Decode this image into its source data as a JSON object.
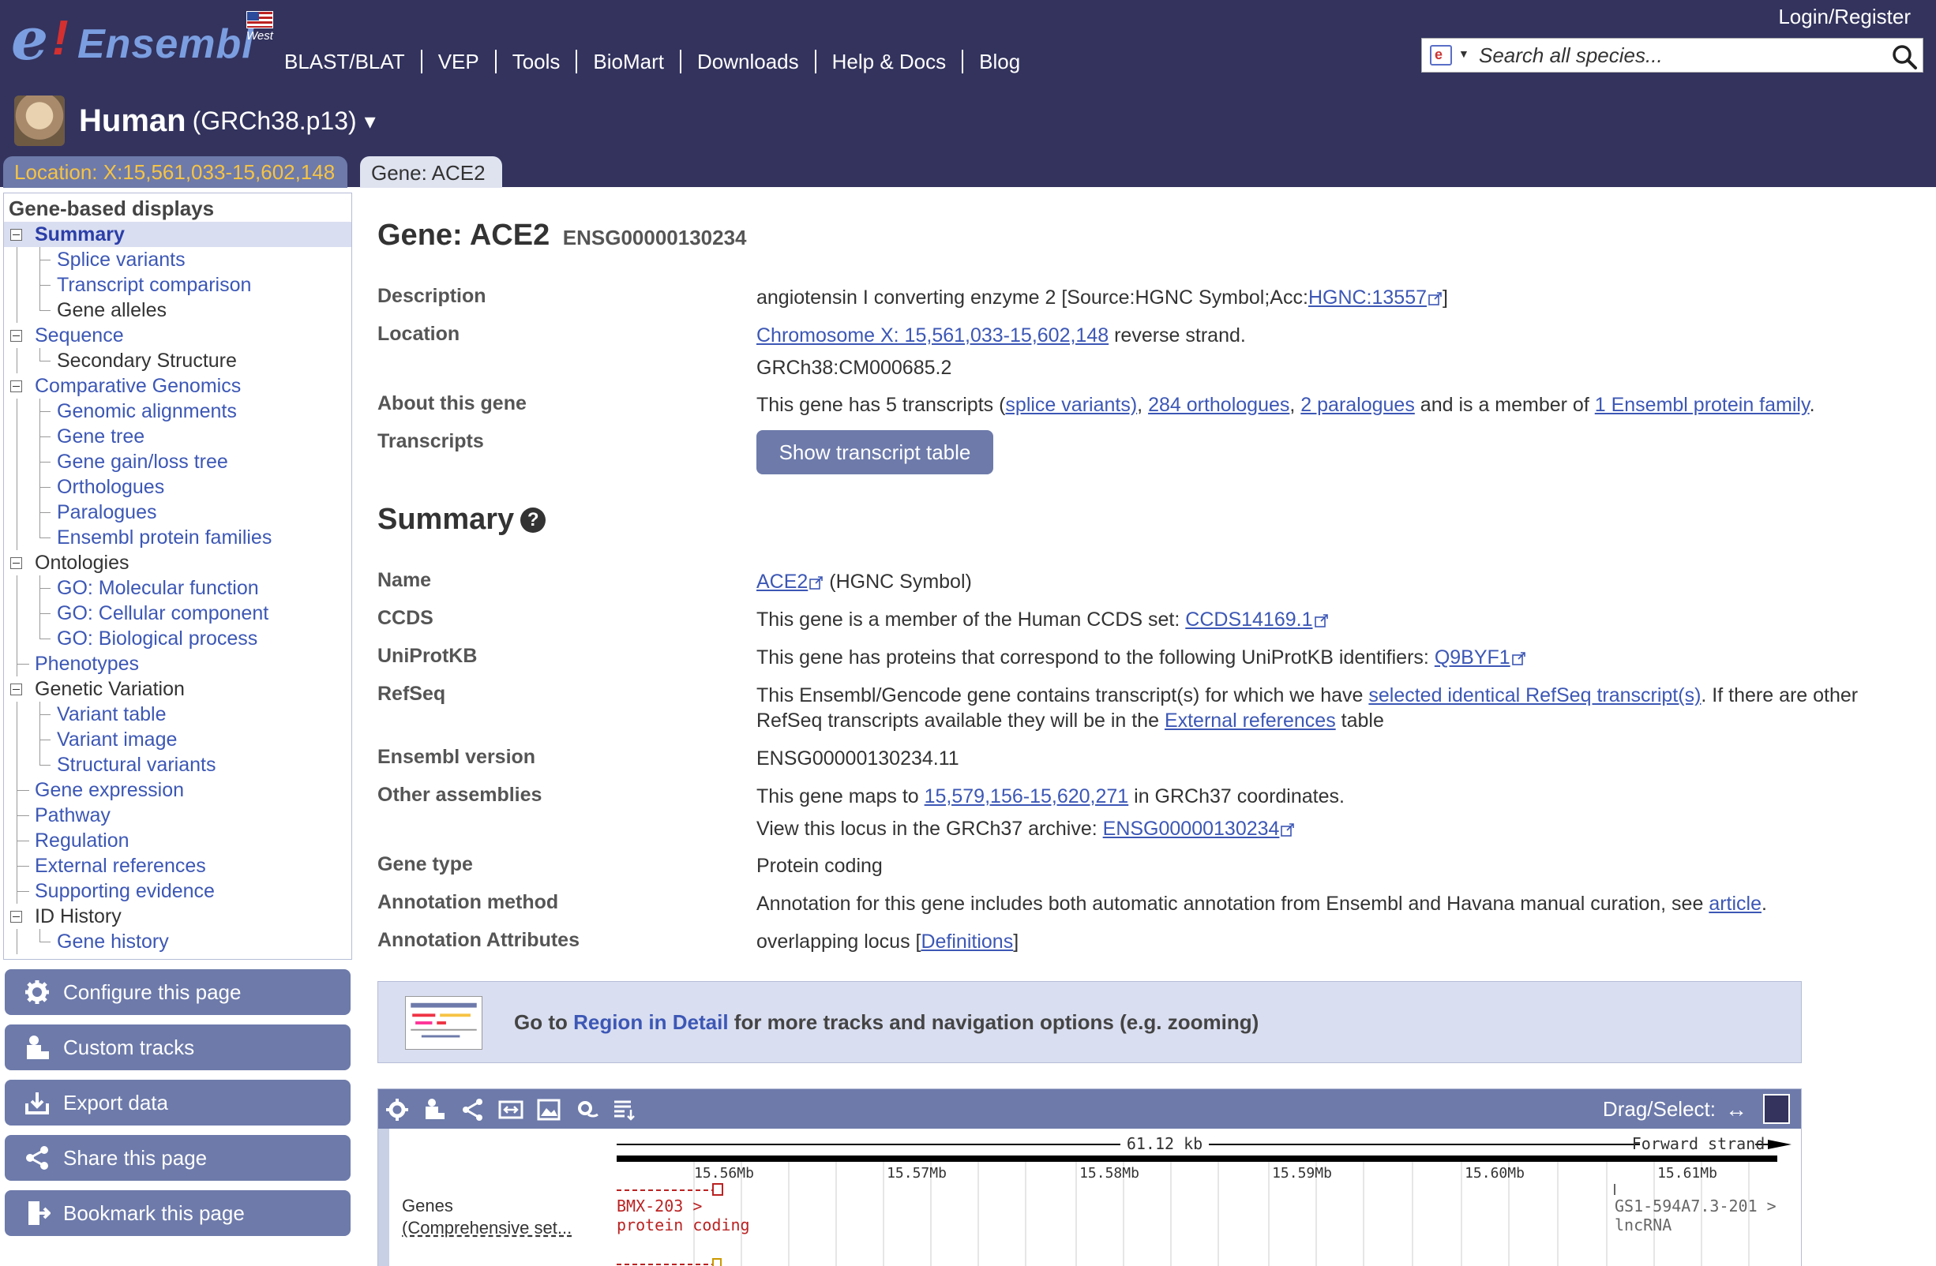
{
  "header": {
    "logo_text": "Ensembl",
    "logo_letter": "e",
    "logo_mark": "!",
    "flag_label": "West",
    "nav": [
      "BLAST/BLAT",
      "VEP",
      "Tools",
      "BioMart",
      "Downloads",
      "Help & Docs",
      "Blog"
    ],
    "login": "Login/Register",
    "search_placeholder": "Search all species..."
  },
  "species": {
    "name": "Human",
    "assembly": "(GRCh38.p13)",
    "dropdown": "▾"
  },
  "tabs": {
    "location": "Location: X:15,561,033-15,602,148",
    "gene": "Gene: ACE2"
  },
  "sidebar": {
    "title": "Gene-based displays",
    "items": [
      {
        "label": "Summary",
        "level": 0,
        "box": true,
        "active": true,
        "link": true
      },
      {
        "label": "Splice variants",
        "level": 1,
        "link": true
      },
      {
        "label": "Transcript comparison",
        "level": 1,
        "link": true
      },
      {
        "label": "Gene alleles",
        "level": 1,
        "link": false,
        "last": true
      },
      {
        "label": "Sequence",
        "level": 0,
        "box": true,
        "link": true
      },
      {
        "label": "Secondary Structure",
        "level": 1,
        "link": false,
        "last": true
      },
      {
        "label": "Comparative Genomics",
        "level": 0,
        "box": true,
        "link": true
      },
      {
        "label": "Genomic alignments",
        "level": 1,
        "link": true
      },
      {
        "label": "Gene tree",
        "level": 1,
        "link": true
      },
      {
        "label": "Gene gain/loss tree",
        "level": 1,
        "link": true
      },
      {
        "label": "Orthologues",
        "level": 1,
        "link": true
      },
      {
        "label": "Paralogues",
        "level": 1,
        "link": true
      },
      {
        "label": "Ensembl protein families",
        "level": 1,
        "link": true,
        "last": true
      },
      {
        "label": "Ontologies",
        "level": 0,
        "box": true,
        "link": false
      },
      {
        "label": "GO: Molecular function",
        "level": 1,
        "link": true
      },
      {
        "label": "GO: Cellular component",
        "level": 1,
        "link": true
      },
      {
        "label": "GO: Biological process",
        "level": 1,
        "link": true,
        "last": true
      },
      {
        "label": "Phenotypes",
        "level": 0,
        "link": true
      },
      {
        "label": "Genetic Variation",
        "level": 0,
        "box": true,
        "link": false
      },
      {
        "label": "Variant table",
        "level": 1,
        "link": true
      },
      {
        "label": "Variant image",
        "level": 1,
        "link": true
      },
      {
        "label": "Structural variants",
        "level": 1,
        "link": true,
        "last": true
      },
      {
        "label": "Gene expression",
        "level": 0,
        "link": true
      },
      {
        "label": "Pathway",
        "level": 0,
        "link": true
      },
      {
        "label": "Regulation",
        "level": 0,
        "link": true
      },
      {
        "label": "External references",
        "level": 0,
        "link": true
      },
      {
        "label": "Supporting evidence",
        "level": 0,
        "link": true
      },
      {
        "label": "ID History",
        "level": 0,
        "box": true,
        "link": false
      },
      {
        "label": "Gene history",
        "level": 1,
        "link": true,
        "last": true
      }
    ],
    "tools": [
      {
        "label": "Configure this page",
        "icon": "gear-icon"
      },
      {
        "label": "Custom tracks",
        "icon": "custom-tracks-icon"
      },
      {
        "label": "Export data",
        "icon": "export-icon"
      },
      {
        "label": "Share this page",
        "icon": "share-icon"
      },
      {
        "label": "Bookmark this page",
        "icon": "bookmark-icon"
      }
    ]
  },
  "gene": {
    "heading": "Gene: ACE2",
    "stable_id": "ENSG00000130234",
    "description_key": "Description",
    "description_text": "angiotensin I converting enzyme 2 [Source:HGNC Symbol;Acc:",
    "description_link": "HGNC:13557",
    "description_end": "]",
    "location_key": "Location",
    "location_link": "Chromosome X: 15,561,033-15,602,148",
    "location_strand": " reverse strand.",
    "location_accession": "GRCh38:CM000685.2",
    "about_key": "About this gene",
    "about_pre": "This gene has 5 transcripts (",
    "about_link1": "splice variants)",
    "about_sep1": ", ",
    "about_link2": "284 orthologues",
    "about_sep2": ", ",
    "about_link3": "2 paralogues",
    "about_mid": " and is a member of ",
    "about_link4": "1 Ensembl protein family",
    "about_end": ".",
    "transcripts_key": "Transcripts",
    "transcripts_button": "Show transcript table"
  },
  "summary": {
    "heading": "Summary",
    "help": "?",
    "name_key": "Name",
    "name_link": "ACE2",
    "name_rest": " (HGNC Symbol)",
    "ccds_key": "CCDS",
    "ccds_text": "This gene is a member of the Human CCDS set: ",
    "ccds_link": "CCDS14169.1",
    "uniprot_key": "UniProtKB",
    "uniprot_text": "This gene has proteins that correspond to the following UniProtKB identifiers: ",
    "uniprot_link": "Q9BYF1",
    "refseq_key": "RefSeq",
    "refseq_pre": "This Ensembl/Gencode gene contains transcript(s) for which we have ",
    "refseq_link1": "selected identical RefSeq transcript(s)",
    "refseq_mid": ". If there are other RefSeq transcripts available they will be in the ",
    "refseq_link2": "External references",
    "refseq_end": " table",
    "version_key": "Ensembl version",
    "version_value": "ENSG00000130234.11",
    "other_key": "Other assemblies",
    "other_pre": "This gene maps to ",
    "other_link": "15,579,156-15,620,271",
    "other_post": " in GRCh37 coordinates.",
    "other_archive_pre": "View this locus in the GRCh37 archive: ",
    "other_archive_link": "ENSG00000130234",
    "type_key": "Gene type",
    "type_value": "Protein coding",
    "method_key": "Annotation method",
    "method_text": "Annotation for this gene includes both automatic annotation from Ensembl and Havana manual curation, see ",
    "method_link": "article",
    "method_end": ".",
    "attr_key": "Annotation Attributes",
    "attr_text": "overlapping locus [",
    "attr_link": "Definitions",
    "attr_end": "]"
  },
  "region": {
    "pre": "Go to ",
    "link": "Region in Detail",
    "post": " for more tracks and navigation options (e.g. zooming)"
  },
  "image": {
    "drag_select": "Drag/Select:",
    "drag_arrow": "↔",
    "scale_label": "61.12 kb",
    "strand_label": "Forward strand",
    "ticks": [
      "15.56Mb",
      "15.57Mb",
      "15.58Mb",
      "15.59Mb",
      "15.60Mb",
      "15.61Mb"
    ],
    "track_label_1": "Genes",
    "track_label_2": "(Comprehensive set...",
    "gene1_name": "BMX-203 >",
    "gene1_type": "protein coding",
    "gene2_name": "GS1-594A7.3-201 >",
    "gene2_type": "lncRNA"
  },
  "colors": {
    "header_bg": "#33335e",
    "accent": "#6d7aaa",
    "link": "#3c57b5",
    "location_tab_text": "#f6c344",
    "panel_bg": "#d9def0"
  }
}
